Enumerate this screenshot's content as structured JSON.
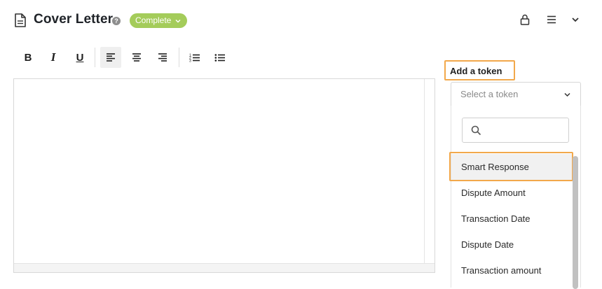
{
  "header": {
    "title": "Cover Letter",
    "help_glyph": "?",
    "status": "Complete",
    "icons": [
      "document-icon",
      "help-icon",
      "lock-icon",
      "menu-icon",
      "chevron-down-icon"
    ]
  },
  "toolbar": {
    "bold": "B",
    "italic": "I",
    "underline": "U"
  },
  "token_panel": {
    "label": "Add a token",
    "select_placeholder": "Select a token",
    "options": [
      "Smart Response",
      "Dispute Amount",
      "Transaction Date",
      "Dispute Date",
      "Transaction amount"
    ]
  },
  "colors": {
    "status_badge": "#a4cc5a",
    "highlight_frame": "#f2a84b",
    "active_button_bg": "#efefef"
  }
}
